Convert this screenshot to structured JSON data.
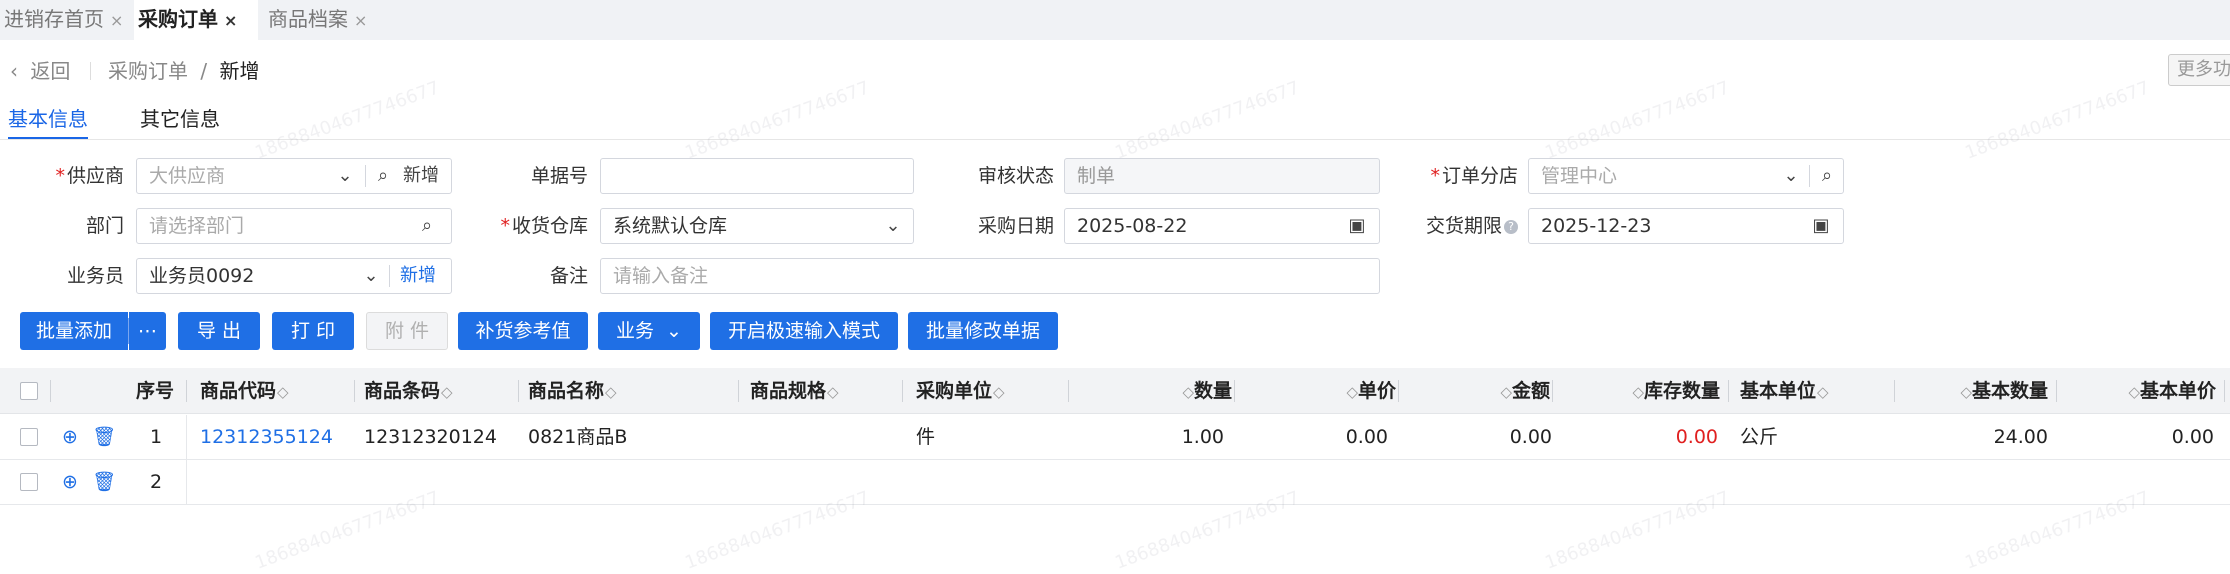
{
  "page_tabs": [
    {
      "label": "进销存首页",
      "close": "×"
    },
    {
      "label": "采购订单",
      "close": "×"
    },
    {
      "label": "商品档案",
      "close": "×"
    }
  ],
  "breadcrumb": {
    "back": "返回",
    "parent": "采购订单",
    "separator": "/",
    "current": "新增"
  },
  "more_button": "更多功",
  "tabs": [
    "基本信息",
    "其它信息"
  ],
  "form": {
    "supplier": {
      "label": "供应商",
      "required": "*",
      "value": "大供应商",
      "add": "新增"
    },
    "bill_no": {
      "label": "单据号",
      "value": ""
    },
    "audit_status": {
      "label": "审核状态",
      "placeholder": "制单"
    },
    "branch": {
      "label": "订单分店",
      "required": "*",
      "value": "管理中心"
    },
    "department": {
      "label": "部门",
      "placeholder": "请选择部门"
    },
    "warehouse": {
      "label": "收货仓库",
      "required": "*",
      "value": "系统默认仓库"
    },
    "purchase_date": {
      "label": "采购日期",
      "value": "2025-08-22"
    },
    "delivery_deadline": {
      "label": "交货期限",
      "value": "2025-12-23"
    },
    "salesman": {
      "label": "业务员",
      "value": "业务员0092",
      "add": "新增"
    },
    "remark": {
      "label": "备注",
      "placeholder": "请输入备注"
    }
  },
  "toolbar": {
    "batch_add": "批量添加",
    "more": "⋯",
    "export": "导 出",
    "print": "打 印",
    "attachment": "附 件",
    "replenish": "补货参考值",
    "business": "业务",
    "fast_mode": "开启极速输入模式",
    "batch_modify": "批量修改单据"
  },
  "table": {
    "columns": {
      "seq": "序号",
      "code": "商品代码",
      "barcode": "商品条码",
      "name": "商品名称",
      "spec": "商品规格",
      "purchase_unit": "采购单位",
      "qty": "数量",
      "price": "单价",
      "amount": "金额",
      "stock_qty": "库存数量",
      "base_unit": "基本单位",
      "base_qty": "基本数量",
      "base_price": "基本单价"
    },
    "rows": [
      {
        "seq": "1",
        "code": "12312355124",
        "barcode": "12312320124",
        "name": "0821商品B",
        "spec": "",
        "purchase_unit": "件",
        "qty": "1.00",
        "price": "0.00",
        "amount": "0.00",
        "stock_qty": "0.00",
        "base_unit": "公斤",
        "base_qty": "24.00",
        "base_price": "0.00"
      },
      {
        "seq": "2"
      }
    ]
  },
  "watermark": "18688404677746677",
  "colors": {
    "primary": "#1f6fe5",
    "required": "#e02020",
    "negative": "#e02020"
  }
}
